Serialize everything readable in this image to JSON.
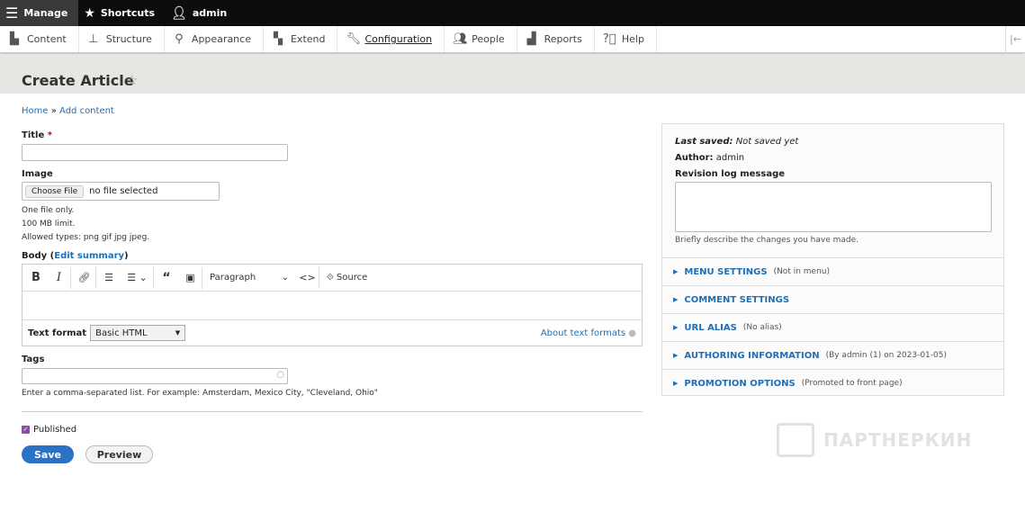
{
  "toolbar": {
    "manage": "Manage",
    "shortcuts": "Shortcuts",
    "user": "admin"
  },
  "nav": [
    {
      "label": "Content",
      "icon": "document-icon"
    },
    {
      "label": "Structure",
      "icon": "sitemap-icon"
    },
    {
      "label": "Appearance",
      "icon": "brush-icon"
    },
    {
      "label": "Extend",
      "icon": "puzzle-icon"
    },
    {
      "label": "Configuration",
      "icon": "wrench-icon"
    },
    {
      "label": "People",
      "icon": "people-icon"
    },
    {
      "label": "Reports",
      "icon": "bar-chart-icon"
    },
    {
      "label": "Help",
      "icon": "help-icon"
    }
  ],
  "page": {
    "title": "Create Article"
  },
  "breadcrumb": {
    "home": "Home",
    "sep": "»",
    "add": "Add content"
  },
  "form": {
    "title_label": "Title",
    "required": "*",
    "image_label": "Image",
    "choose_file": "Choose File",
    "no_file": "no file selected",
    "image_help": [
      "One file only.",
      "100 MB limit.",
      "Allowed types: png gif jpg jpeg."
    ],
    "body_label": "Body",
    "edit_summary": "Edit summary",
    "paragraph": "Paragraph",
    "source": "Source",
    "text_format_label": "Text format",
    "text_format_value": "Basic HTML",
    "about_formats": "About text formats",
    "tags_label": "Tags",
    "tags_help": "Enter a comma-separated list. For example: Amsterdam, Mexico City, \"Cleveland, Ohio\"",
    "published": "Published",
    "published_checked": true,
    "save": "Save",
    "preview": "Preview"
  },
  "sidebar": {
    "last_saved_label": "Last saved:",
    "last_saved_value": "Not saved yet",
    "author_label": "Author:",
    "author_value": "admin",
    "revision_label": "Revision log message",
    "revision_help": "Briefly describe the changes you have made.",
    "details": [
      {
        "title": "MENU SETTINGS",
        "summary": "(Not in menu)"
      },
      {
        "title": "COMMENT SETTINGS",
        "summary": ""
      },
      {
        "title": "URL ALIAS",
        "summary": "(No alias)"
      },
      {
        "title": "AUTHORING INFORMATION",
        "summary": "(By admin (1) on 2023-01-05)"
      },
      {
        "title": "PROMOTION OPTIONS",
        "summary": "(Promoted to front page)"
      }
    ]
  },
  "watermark": "ПАРТНЕРКИН"
}
